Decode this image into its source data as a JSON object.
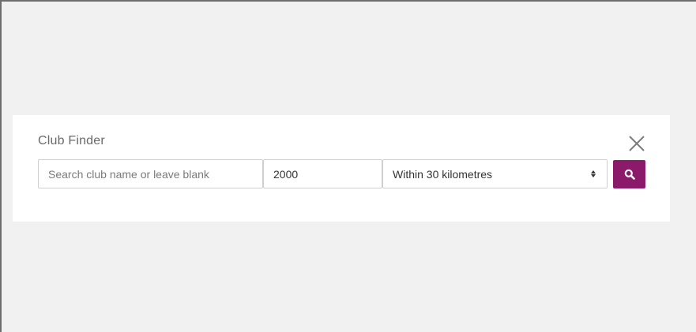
{
  "club_finder": {
    "title": "Club Finder",
    "search_placeholder": "Search club name or leave blank",
    "search_value": "",
    "postcode_value": "2000",
    "distance_selected": "Within 30 kilometres"
  },
  "icons": {
    "close": "close-icon",
    "search": "search-icon",
    "select_arrows": "select-arrows-icon"
  },
  "colors": {
    "accent": "#8b1a6b",
    "page_background": "#f1f1f1",
    "panel_background": "#ffffff"
  }
}
